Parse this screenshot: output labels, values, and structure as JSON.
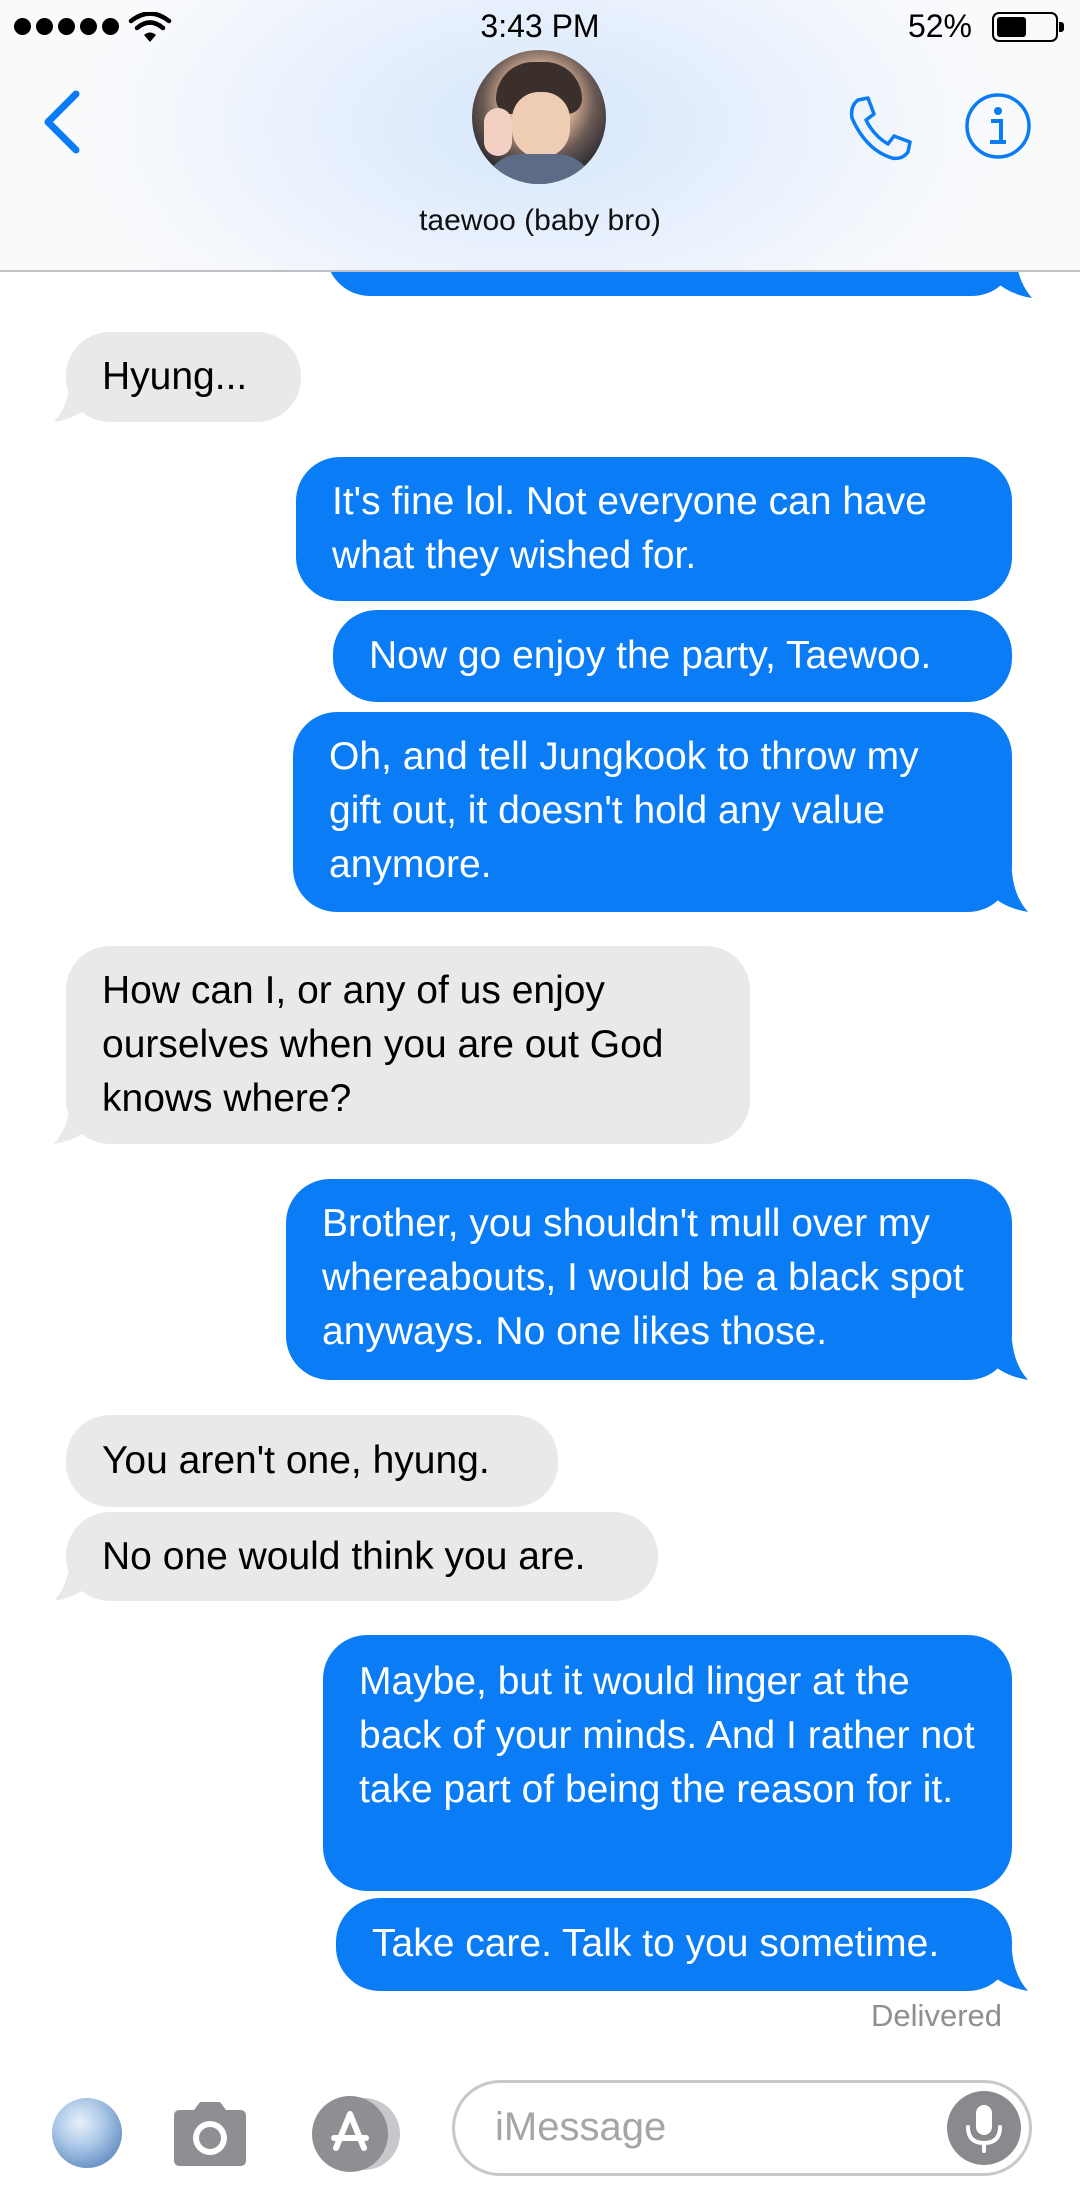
{
  "status_bar": {
    "time": "3:43 PM",
    "battery_percent": "52%",
    "battery_level": 0.52,
    "signal_bars": 5
  },
  "header": {
    "contact_name": "taewoo (baby bro)",
    "back_icon": "chevron-left-icon",
    "call_icon": "phone-icon",
    "info_icon": "info-icon"
  },
  "messages": [
    {
      "direction": "in",
      "text": "Hyung..."
    },
    {
      "direction": "out",
      "text": "It's fine lol. Not everyone can have what they wished for."
    },
    {
      "direction": "out",
      "text": "Now go enjoy the party, Taewoo."
    },
    {
      "direction": "out",
      "text": "Oh, and tell Jungkook to throw my gift out, it doesn't hold any value anymore."
    },
    {
      "direction": "in",
      "text": "How can I, or any of us enjoy ourselves when you are out God knows where?"
    },
    {
      "direction": "out",
      "text": "Brother, you shouldn't mull over my whereabouts, I would be a black spot anyways. No one likes those."
    },
    {
      "direction": "in",
      "text": "You aren't one, hyung."
    },
    {
      "direction": "in",
      "text": "No one would think you are."
    },
    {
      "direction": "out",
      "text": "Maybe, but it would linger at the back of your minds. And I rather not take part of being the reason for it."
    },
    {
      "direction": "out",
      "text": "Take care. Talk to you sometime."
    }
  ],
  "delivered_label": "Delivered",
  "input_bar": {
    "placeholder": "iMessage",
    "photos_icon": "photos-icon",
    "camera_icon": "camera-icon",
    "appstore_icon": "app-store-icon",
    "mic_icon": "microphone-icon"
  },
  "colors": {
    "outgoing_bubble": "#0a7cf5",
    "incoming_bubble": "#e9e9eb",
    "accent": "#0a7cf5"
  }
}
